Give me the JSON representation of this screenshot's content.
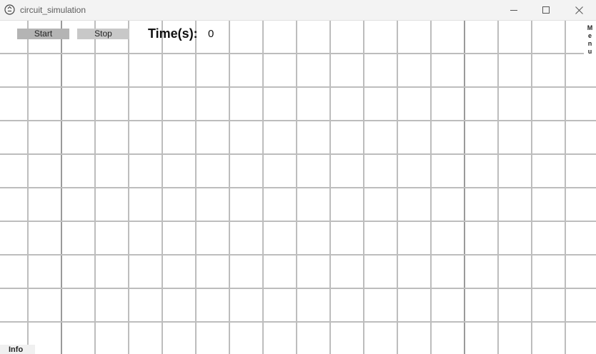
{
  "window": {
    "title": "circuit_simulation",
    "icons": {
      "app": "app-icon",
      "minimize": "minimize-icon",
      "maximize": "maximize-icon",
      "close": "close-icon"
    }
  },
  "toolbar": {
    "start_label": "Start",
    "stop_label": "Stop",
    "time_label": "Time(s):",
    "time_value": "0"
  },
  "menu": {
    "label": "Menu"
  },
  "info": {
    "label": "Info"
  },
  "grid": {
    "line_color": "#bdbdbd"
  }
}
